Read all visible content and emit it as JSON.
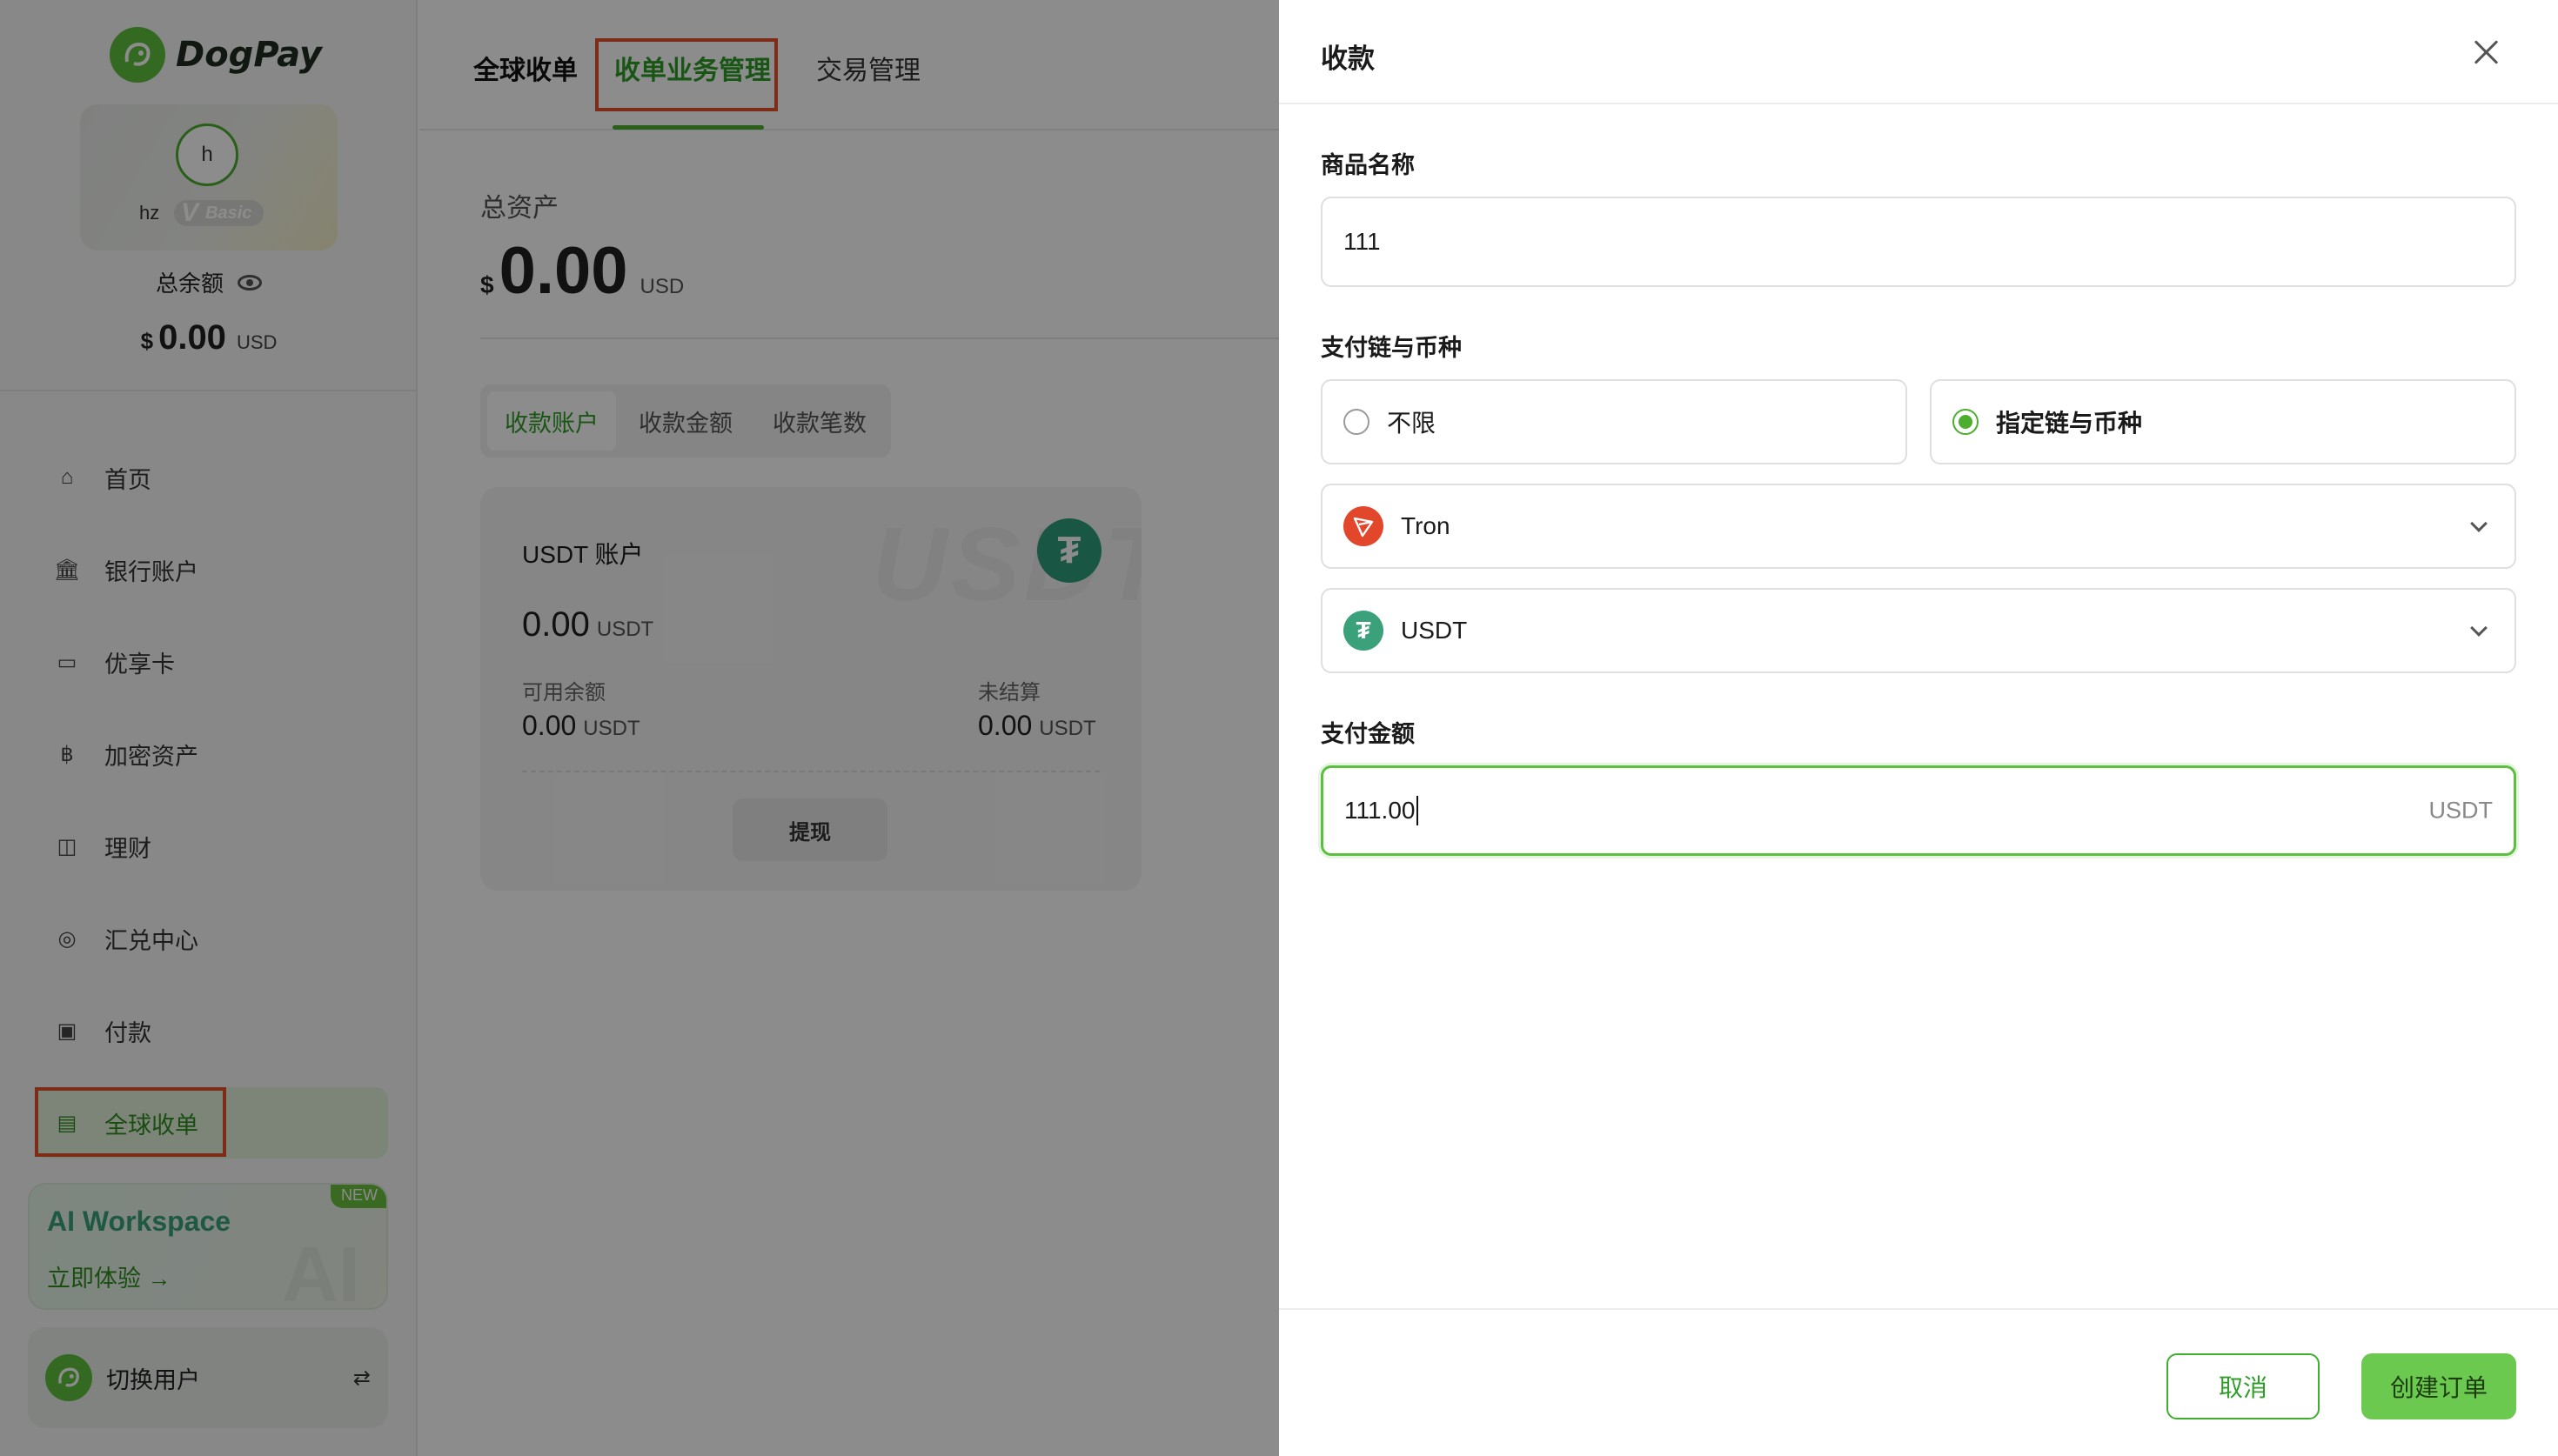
{
  "sidebar": {
    "logo_text": "DogPay",
    "user": {
      "avatar_initial": "h",
      "name": "hz",
      "tier": "Basic"
    },
    "balance_label": "总余额",
    "balance": {
      "currency_symbol": "$",
      "amount": "0.00",
      "unit": "USD"
    },
    "nav": [
      {
        "label": "首页",
        "icon": "home-icon"
      },
      {
        "label": "银行账户",
        "icon": "bank-icon"
      },
      {
        "label": "优享卡",
        "icon": "card-icon"
      },
      {
        "label": "加密资产",
        "icon": "bitcoin-icon"
      },
      {
        "label": "理财",
        "icon": "chart-icon"
      },
      {
        "label": "汇兑中心",
        "icon": "exchange-icon"
      },
      {
        "label": "付款",
        "icon": "wallet-icon"
      },
      {
        "label": "全球收单",
        "icon": "receipt-icon",
        "active": true
      }
    ],
    "ai_card": {
      "title": "AI Workspace",
      "link": "立即体验 →",
      "badge": "NEW"
    },
    "switch_user": "切换用户"
  },
  "main": {
    "tabs": [
      {
        "label": "全球收单"
      },
      {
        "label": "收单业务管理",
        "active": true
      },
      {
        "label": "交易管理"
      }
    ],
    "assets_label": "总资产",
    "assets": {
      "currency_symbol": "$",
      "amount": "0.00",
      "unit": "USD"
    },
    "subtabs": [
      {
        "label": "收款账户",
        "active": true
      },
      {
        "label": "收款金额"
      },
      {
        "label": "收款笔数"
      }
    ],
    "usdt_card": {
      "title": "USDT 账户",
      "watermark": "USDT",
      "amount": "0.00",
      "unit": "USDT",
      "available_label": "可用余额",
      "available": "0.00",
      "unsettled_label": "未结算",
      "unsettled": "0.00",
      "withdraw": "提现"
    }
  },
  "drawer": {
    "title": "收款",
    "product_label": "商品名称",
    "product_value": "111",
    "chain_label": "支付链与币种",
    "radio_unlimited": "不限",
    "radio_specified": "指定链与币种",
    "chain_select": "Tron",
    "currency_select": "USDT",
    "amount_label": "支付金额",
    "amount_value": "111.00",
    "amount_suffix": "USDT",
    "cancel": "取消",
    "create": "创建订单"
  },
  "colors": {
    "brand_green": "#4cae2f",
    "highlight_red": "#e4502a",
    "tron_red": "#e2462b",
    "usdt_teal": "#2e9e7d"
  }
}
